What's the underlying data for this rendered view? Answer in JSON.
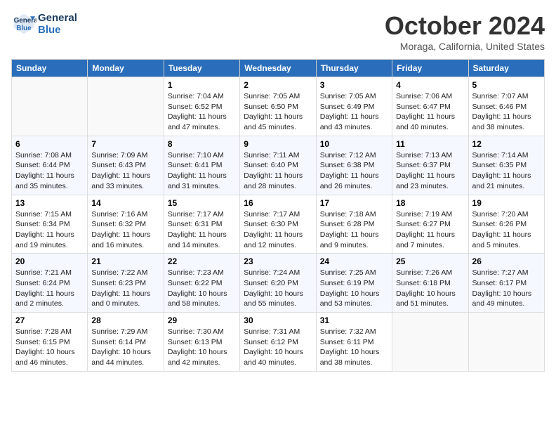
{
  "header": {
    "logo_line1": "General",
    "logo_line2": "Blue",
    "month_title": "October 2024",
    "location": "Moraga, California, United States"
  },
  "days_of_week": [
    "Sunday",
    "Monday",
    "Tuesday",
    "Wednesday",
    "Thursday",
    "Friday",
    "Saturday"
  ],
  "weeks": [
    [
      {
        "day": "",
        "empty": true
      },
      {
        "day": "",
        "empty": true
      },
      {
        "day": "1",
        "sunrise": "Sunrise: 7:04 AM",
        "sunset": "Sunset: 6:52 PM",
        "daylight": "Daylight: 11 hours and 47 minutes."
      },
      {
        "day": "2",
        "sunrise": "Sunrise: 7:05 AM",
        "sunset": "Sunset: 6:50 PM",
        "daylight": "Daylight: 11 hours and 45 minutes."
      },
      {
        "day": "3",
        "sunrise": "Sunrise: 7:05 AM",
        "sunset": "Sunset: 6:49 PM",
        "daylight": "Daylight: 11 hours and 43 minutes."
      },
      {
        "day": "4",
        "sunrise": "Sunrise: 7:06 AM",
        "sunset": "Sunset: 6:47 PM",
        "daylight": "Daylight: 11 hours and 40 minutes."
      },
      {
        "day": "5",
        "sunrise": "Sunrise: 7:07 AM",
        "sunset": "Sunset: 6:46 PM",
        "daylight": "Daylight: 11 hours and 38 minutes."
      }
    ],
    [
      {
        "day": "6",
        "sunrise": "Sunrise: 7:08 AM",
        "sunset": "Sunset: 6:44 PM",
        "daylight": "Daylight: 11 hours and 35 minutes."
      },
      {
        "day": "7",
        "sunrise": "Sunrise: 7:09 AM",
        "sunset": "Sunset: 6:43 PM",
        "daylight": "Daylight: 11 hours and 33 minutes."
      },
      {
        "day": "8",
        "sunrise": "Sunrise: 7:10 AM",
        "sunset": "Sunset: 6:41 PM",
        "daylight": "Daylight: 11 hours and 31 minutes."
      },
      {
        "day": "9",
        "sunrise": "Sunrise: 7:11 AM",
        "sunset": "Sunset: 6:40 PM",
        "daylight": "Daylight: 11 hours and 28 minutes."
      },
      {
        "day": "10",
        "sunrise": "Sunrise: 7:12 AM",
        "sunset": "Sunset: 6:38 PM",
        "daylight": "Daylight: 11 hours and 26 minutes."
      },
      {
        "day": "11",
        "sunrise": "Sunrise: 7:13 AM",
        "sunset": "Sunset: 6:37 PM",
        "daylight": "Daylight: 11 hours and 23 minutes."
      },
      {
        "day": "12",
        "sunrise": "Sunrise: 7:14 AM",
        "sunset": "Sunset: 6:35 PM",
        "daylight": "Daylight: 11 hours and 21 minutes."
      }
    ],
    [
      {
        "day": "13",
        "sunrise": "Sunrise: 7:15 AM",
        "sunset": "Sunset: 6:34 PM",
        "daylight": "Daylight: 11 hours and 19 minutes."
      },
      {
        "day": "14",
        "sunrise": "Sunrise: 7:16 AM",
        "sunset": "Sunset: 6:32 PM",
        "daylight": "Daylight: 11 hours and 16 minutes."
      },
      {
        "day": "15",
        "sunrise": "Sunrise: 7:17 AM",
        "sunset": "Sunset: 6:31 PM",
        "daylight": "Daylight: 11 hours and 14 minutes."
      },
      {
        "day": "16",
        "sunrise": "Sunrise: 7:17 AM",
        "sunset": "Sunset: 6:30 PM",
        "daylight": "Daylight: 11 hours and 12 minutes."
      },
      {
        "day": "17",
        "sunrise": "Sunrise: 7:18 AM",
        "sunset": "Sunset: 6:28 PM",
        "daylight": "Daylight: 11 hours and 9 minutes."
      },
      {
        "day": "18",
        "sunrise": "Sunrise: 7:19 AM",
        "sunset": "Sunset: 6:27 PM",
        "daylight": "Daylight: 11 hours and 7 minutes."
      },
      {
        "day": "19",
        "sunrise": "Sunrise: 7:20 AM",
        "sunset": "Sunset: 6:26 PM",
        "daylight": "Daylight: 11 hours and 5 minutes."
      }
    ],
    [
      {
        "day": "20",
        "sunrise": "Sunrise: 7:21 AM",
        "sunset": "Sunset: 6:24 PM",
        "daylight": "Daylight: 11 hours and 2 minutes."
      },
      {
        "day": "21",
        "sunrise": "Sunrise: 7:22 AM",
        "sunset": "Sunset: 6:23 PM",
        "daylight": "Daylight: 11 hours and 0 minutes."
      },
      {
        "day": "22",
        "sunrise": "Sunrise: 7:23 AM",
        "sunset": "Sunset: 6:22 PM",
        "daylight": "Daylight: 10 hours and 58 minutes."
      },
      {
        "day": "23",
        "sunrise": "Sunrise: 7:24 AM",
        "sunset": "Sunset: 6:20 PM",
        "daylight": "Daylight: 10 hours and 55 minutes."
      },
      {
        "day": "24",
        "sunrise": "Sunrise: 7:25 AM",
        "sunset": "Sunset: 6:19 PM",
        "daylight": "Daylight: 10 hours and 53 minutes."
      },
      {
        "day": "25",
        "sunrise": "Sunrise: 7:26 AM",
        "sunset": "Sunset: 6:18 PM",
        "daylight": "Daylight: 10 hours and 51 minutes."
      },
      {
        "day": "26",
        "sunrise": "Sunrise: 7:27 AM",
        "sunset": "Sunset: 6:17 PM",
        "daylight": "Daylight: 10 hours and 49 minutes."
      }
    ],
    [
      {
        "day": "27",
        "sunrise": "Sunrise: 7:28 AM",
        "sunset": "Sunset: 6:15 PM",
        "daylight": "Daylight: 10 hours and 46 minutes."
      },
      {
        "day": "28",
        "sunrise": "Sunrise: 7:29 AM",
        "sunset": "Sunset: 6:14 PM",
        "daylight": "Daylight: 10 hours and 44 minutes."
      },
      {
        "day": "29",
        "sunrise": "Sunrise: 7:30 AM",
        "sunset": "Sunset: 6:13 PM",
        "daylight": "Daylight: 10 hours and 42 minutes."
      },
      {
        "day": "30",
        "sunrise": "Sunrise: 7:31 AM",
        "sunset": "Sunset: 6:12 PM",
        "daylight": "Daylight: 10 hours and 40 minutes."
      },
      {
        "day": "31",
        "sunrise": "Sunrise: 7:32 AM",
        "sunset": "Sunset: 6:11 PM",
        "daylight": "Daylight: 10 hours and 38 minutes."
      },
      {
        "day": "",
        "empty": true
      },
      {
        "day": "",
        "empty": true
      }
    ]
  ]
}
